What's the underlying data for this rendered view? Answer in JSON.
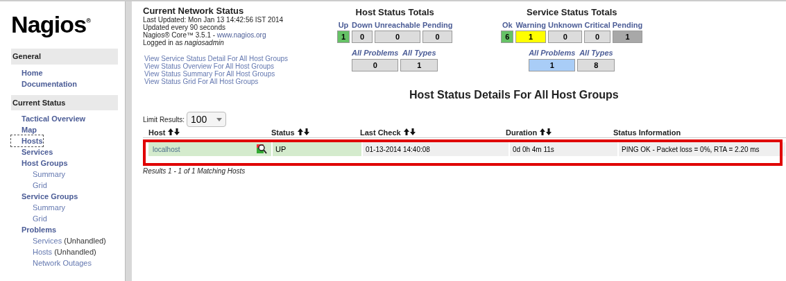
{
  "sidebar": {
    "logo": "Nagios",
    "logo_mark": "®",
    "sections": [
      {
        "title": "General",
        "items": [
          {
            "label": "Home",
            "selected": false
          },
          {
            "label": "Documentation",
            "selected": false
          }
        ]
      },
      {
        "title": "Current Status",
        "items": [
          {
            "label": "Tactical Overview",
            "selected": false
          },
          {
            "label": "Map",
            "selected": false
          },
          {
            "label": "Hosts",
            "selected": true
          },
          {
            "label": "Services",
            "selected": false
          },
          {
            "label": "Host Groups",
            "selected": false,
            "children": [
              {
                "label": "Summary"
              },
              {
                "label": "Grid"
              }
            ]
          },
          {
            "label": "Service Groups",
            "selected": false,
            "children": [
              {
                "label": "Summary"
              },
              {
                "label": "Grid"
              }
            ]
          },
          {
            "label": "Problems",
            "selected": false,
            "children": [
              {
                "label": "Services",
                "suffix": "(Unhandled)"
              },
              {
                "label": "Hosts",
                "suffix": "(Unhandled)"
              },
              {
                "label": "Network Outages"
              }
            ]
          }
        ]
      }
    ]
  },
  "status_info": {
    "title": "Current Network Status",
    "last_updated": "Last Updated: Mon Jan 13 14:42:56 IST 2014",
    "interval": "Updated every 90 seconds",
    "version": "Nagios® Core™ 3.5.1 - ",
    "version_link": "www.nagios.org",
    "login": "Logged in as ",
    "user": "nagiosadmin",
    "links": [
      "View Service Status Detail For All Host Groups",
      "View Status Overview For All Host Groups",
      "View Status Summary For All Host Groups",
      "View Status Grid For All Host Groups"
    ]
  },
  "host_totals": {
    "title": "Host Status Totals",
    "cells": [
      {
        "label": "Up",
        "value": "1",
        "color": "#66c266"
      },
      {
        "label": "Down",
        "value": "0",
        "color": "#dcdcdc"
      },
      {
        "label": "Unreachable",
        "value": "0",
        "color": "#dcdcdc"
      },
      {
        "label": "Pending",
        "value": "0",
        "color": "#dcdcdc"
      }
    ],
    "summary": [
      {
        "label": "All Problems",
        "value": "0",
        "color": "#dcdcdc"
      },
      {
        "label": "All Types",
        "value": "1",
        "color": "#dcdcdc"
      }
    ]
  },
  "service_totals": {
    "title": "Service Status Totals",
    "cells": [
      {
        "label": "Ok",
        "value": "6",
        "color": "#66c266"
      },
      {
        "label": "Warning",
        "value": "1",
        "color": "#ffff00"
      },
      {
        "label": "Unknown",
        "value": "0",
        "color": "#dcdcdc"
      },
      {
        "label": "Critical",
        "value": "0",
        "color": "#dcdcdc"
      },
      {
        "label": "Pending",
        "value": "1",
        "color": "#a8a8a8"
      }
    ],
    "summary": [
      {
        "label": "All Problems",
        "value": "1",
        "color": "#a9cdf7"
      },
      {
        "label": "All Types",
        "value": "8",
        "color": "#dcdcdc"
      }
    ]
  },
  "page_title": "Host Status Details For All Host Groups",
  "limit": {
    "label": "Limit Results:",
    "value": "100"
  },
  "table": {
    "columns": [
      "Host",
      "Status",
      "Last Check",
      "Duration",
      "Status Information"
    ],
    "rows": [
      {
        "host": "localhost",
        "status": "UP",
        "color": "#d4ebcd",
        "last_check": "01-13-2014 14:40:08",
        "duration": "0d 0h 4m 11s",
        "info": "PING OK - Packet loss = 0%, RTA = 2.20 ms"
      }
    ]
  },
  "results": "Results 1 - 1 of 1 Matching Hosts"
}
